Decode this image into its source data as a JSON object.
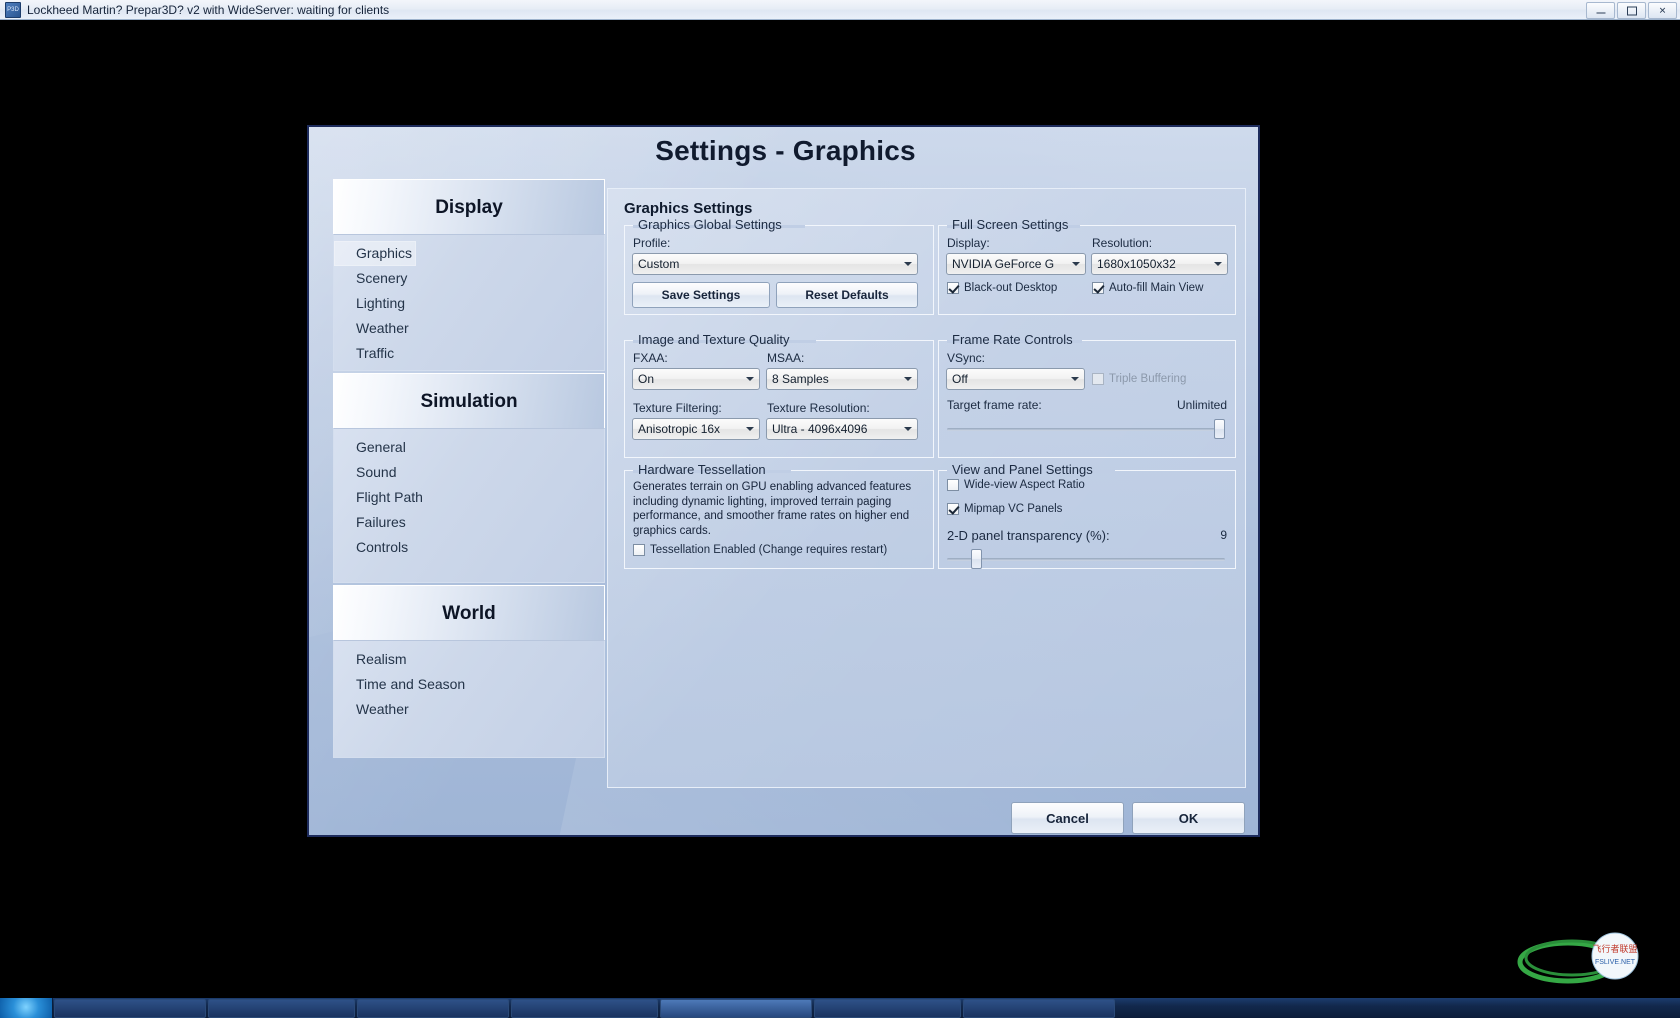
{
  "window": {
    "title": "Lockheed Martin? Prepar3D? v2 with WideServer: waiting for clients",
    "icon": "p3d-app-icon",
    "minimize_label": "—",
    "maximize_label": "□",
    "close_label": "✕"
  },
  "dialog": {
    "title": "Settings - Graphics"
  },
  "sidebar": {
    "groups": [
      {
        "header": "Display",
        "items": [
          {
            "label": "Graphics",
            "active": true
          },
          {
            "label": "Scenery",
            "active": false
          },
          {
            "label": "Lighting",
            "active": false
          },
          {
            "label": "Weather",
            "active": false
          },
          {
            "label": "Traffic",
            "active": false
          }
        ]
      },
      {
        "header": "Simulation",
        "items": [
          {
            "label": "General",
            "active": false
          },
          {
            "label": "Sound",
            "active": false
          },
          {
            "label": "Flight Path",
            "active": false
          },
          {
            "label": "Failures",
            "active": false
          },
          {
            "label": "Controls",
            "active": false
          }
        ]
      },
      {
        "header": "World",
        "items": [
          {
            "label": "Realism",
            "active": false
          },
          {
            "label": "Time and Season",
            "active": false
          },
          {
            "label": "Weather",
            "active": false
          }
        ]
      }
    ]
  },
  "content": {
    "title": "Graphics Settings",
    "global": {
      "legend": "Graphics Global Settings",
      "profile_label": "Profile:",
      "profile_value": "Custom",
      "save_label": "Save Settings",
      "reset_label": "Reset Defaults"
    },
    "image_texture": {
      "legend": "Image and Texture Quality",
      "fxaa_label": "FXAA:",
      "fxaa_value": "On",
      "msaa_label": "MSAA:",
      "msaa_value": "8 Samples",
      "filtering_label": "Texture Filtering:",
      "filtering_value": "Anisotropic 16x",
      "resolution_label": "Texture Resolution:",
      "resolution_value": "Ultra - 4096x4096"
    },
    "tessellation": {
      "legend": "Hardware Tessellation",
      "description": "Generates terrain on GPU enabling advanced features including dynamic lighting, improved terrain paging performance, and smoother frame rates on higher end graphics cards.",
      "enabled_label": "Tessellation Enabled (Change requires restart)",
      "enabled_checked": false
    },
    "fullscreen": {
      "legend": "Full Screen Settings",
      "display_label": "Display:",
      "display_value": "NVIDIA GeForce G",
      "resolution_label": "Resolution:",
      "resolution_value": "1680x1050x32",
      "blackout_label": "Black-out Desktop",
      "blackout_checked": true,
      "autofill_label": "Auto-fill Main View",
      "autofill_checked": true
    },
    "framerate": {
      "legend": "Frame Rate Controls",
      "vsync_label": "VSync:",
      "vsync_value": "Off",
      "triple_buffering_label": "Triple Buffering",
      "triple_buffering_checked": false,
      "triple_buffering_disabled": true,
      "target_label": "Target frame rate:",
      "target_value": "Unlimited",
      "target_slider_percent": 100
    },
    "view_panel": {
      "legend": "View and Panel Settings",
      "wideview_label": "Wide-view Aspect Ratio",
      "wideview_checked": false,
      "mipmap_label": "Mipmap VC Panels",
      "mipmap_checked": true,
      "transparency_label": "2-D panel transparency (%):",
      "transparency_value": "9",
      "transparency_slider_percent": 9
    }
  },
  "footer": {
    "cancel_label": "Cancel",
    "ok_label": "OK"
  }
}
